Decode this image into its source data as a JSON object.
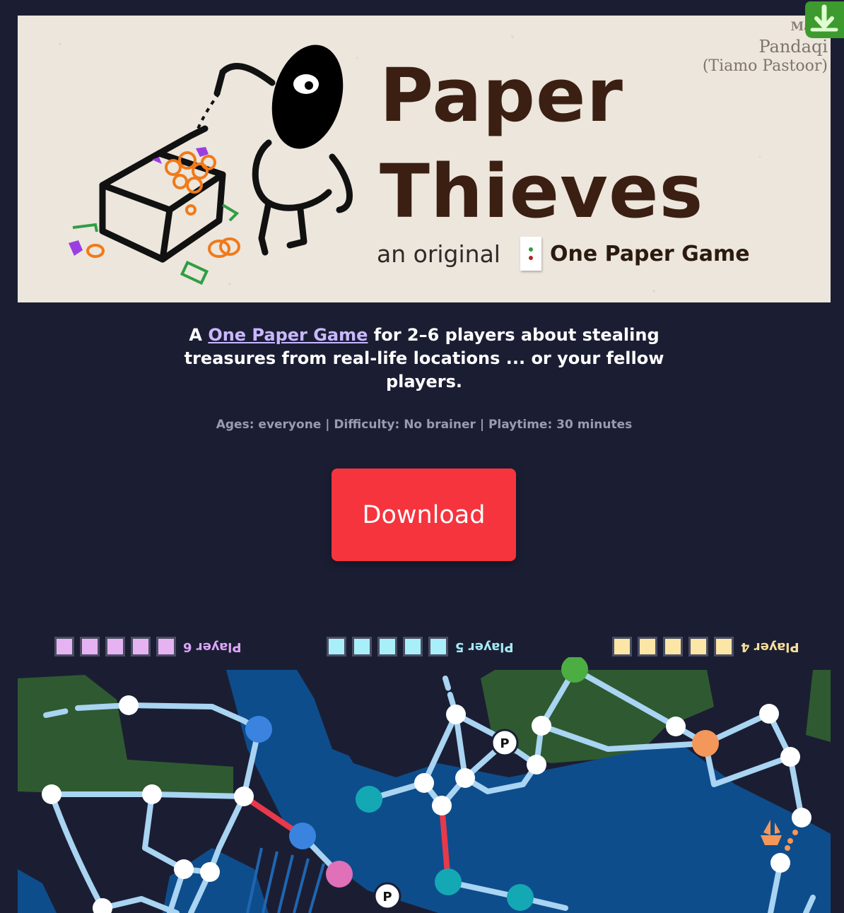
{
  "banner": {
    "title_line_1": "Paper",
    "title_line_2": "Thieves",
    "subtitle_prefix": "an original",
    "subtitle_brand": "One Paper Game",
    "credit_made": "Made",
    "credit_name": "Pandaqi",
    "credit_author": "(Tiamo Pastoor)"
  },
  "intro": {
    "prefix": "A ",
    "link_text": "One Paper Game",
    "suffix": " for 2–6 players about stealing treasures from real-life locations ... or your fellow players."
  },
  "meta": "Ages: everyone | Difficulty: No brainer | Playtime: 30 minutes",
  "download_button": "Download",
  "board": {
    "players": [
      {
        "label": "Player 6",
        "color": "#e6b3f2",
        "text_color": "#d9a6f5"
      },
      {
        "label": "Player 5",
        "color": "#a8effa",
        "text_color": "#a5e9f5"
      },
      {
        "label": "Player 4",
        "color": "#fbe6a6",
        "text_color": "#f7df9a"
      }
    ],
    "parking_label": "P"
  },
  "colors": {
    "background": "#1b1e33",
    "accent_red": "#f5343e",
    "water": "#0e4d8c",
    "land": "#2f5a31",
    "route": "#a9d4f2"
  }
}
